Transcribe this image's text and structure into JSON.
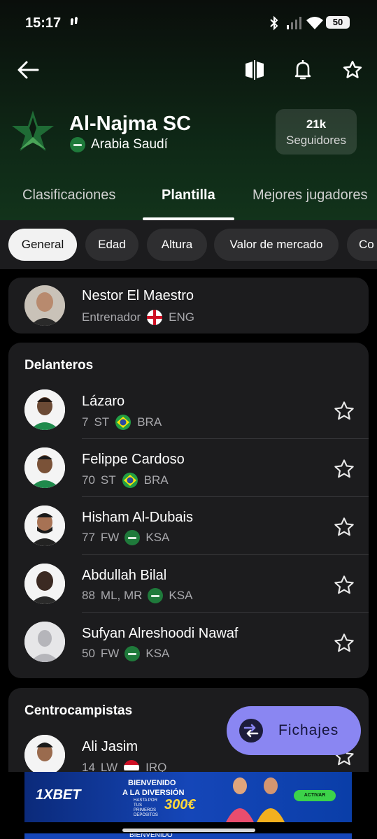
{
  "status_bar": {
    "time": "15:17",
    "battery": "50"
  },
  "team": {
    "name": "Al-Najma SC",
    "country": "Arabia Saudí",
    "followers_count": "21k",
    "followers_label": "Seguidores"
  },
  "tabs": [
    {
      "label": "Clasificaciones"
    },
    {
      "label": "Plantilla"
    },
    {
      "label": "Mejores jugadores"
    }
  ],
  "filters": [
    {
      "label": "General"
    },
    {
      "label": "Edad"
    },
    {
      "label": "Altura"
    },
    {
      "label": "Valor de mercado"
    },
    {
      "label": "Co"
    }
  ],
  "coach": {
    "name": "Nestor El Maestro",
    "role": "Entrenador",
    "country": "ENG"
  },
  "forwards": {
    "title": "Delanteros",
    "players": [
      {
        "name": "Lázaro",
        "number": "7",
        "position": "ST",
        "country": "BRA"
      },
      {
        "name": "Felippe Cardoso",
        "number": "70",
        "position": "ST",
        "country": "BRA"
      },
      {
        "name": "Hisham Al-Dubais",
        "number": "77",
        "position": "FW",
        "country": "KSA"
      },
      {
        "name": "Abdullah Bilal",
        "number": "88",
        "position": "ML, MR",
        "country": "KSA"
      },
      {
        "name": "Sufyan Alreshoodi Nawaf",
        "number": "50",
        "position": "FW",
        "country": "KSA"
      }
    ]
  },
  "midfielders": {
    "title": "Centrocampistas",
    "players": [
      {
        "name": "Ali Jasim",
        "number": "14",
        "position": "LW",
        "country": "IRQ"
      }
    ]
  },
  "fab": {
    "label": "Fichajes"
  },
  "ad": {
    "brand": "1XBET",
    "line1": "BIENVENIDO",
    "line2": "A LA DIVERSIÓN",
    "small": "HASTA POR TUS PRIMEROS DEPÓSITOS",
    "amount": "300€",
    "button": "ACTIVAR",
    "second_banner": "BIENVENIDO"
  },
  "colors": {
    "accent": "#8a86f2",
    "card": "#1c1c1e",
    "header_green": "#12331b"
  }
}
